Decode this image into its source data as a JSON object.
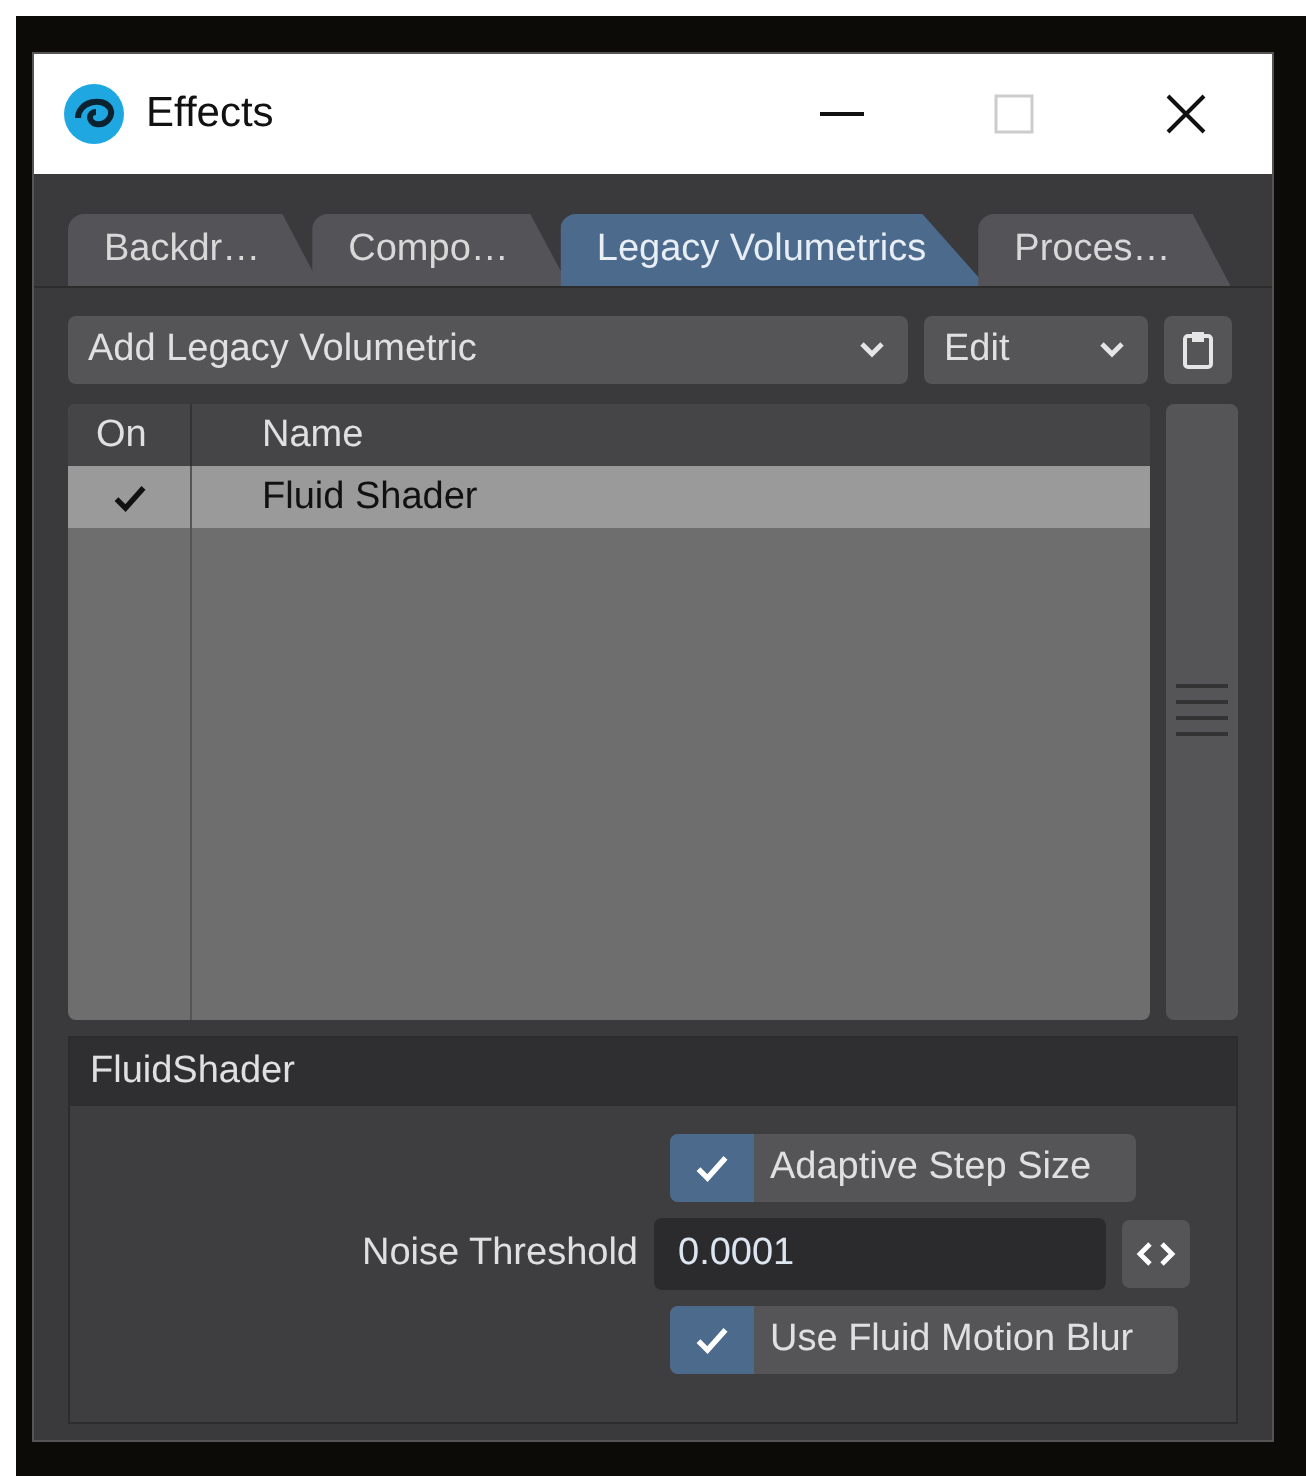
{
  "window": {
    "title": "Effects"
  },
  "tabs": [
    {
      "label": "Backdr…",
      "selected": false
    },
    {
      "label": "Compo…",
      "selected": false
    },
    {
      "label": "Legacy Volumetrics",
      "selected": true
    },
    {
      "label": "Proces…",
      "selected": false
    }
  ],
  "toolbar": {
    "add_menu": "Add Legacy Volumetric",
    "edit_menu": "Edit"
  },
  "table": {
    "columns": [
      "On",
      "Name"
    ],
    "rows": [
      {
        "on": true,
        "name": "Fluid Shader",
        "selected": true
      }
    ]
  },
  "panel": {
    "title": "FluidShader",
    "controls": [
      {
        "kind": "checkbox",
        "label": "Adaptive Step Size",
        "checked": true
      },
      {
        "kind": "number",
        "label": "Noise Threshold",
        "value": "0.0001"
      },
      {
        "kind": "checkbox",
        "label": "Use Fluid Motion Blur",
        "checked": true
      }
    ]
  }
}
